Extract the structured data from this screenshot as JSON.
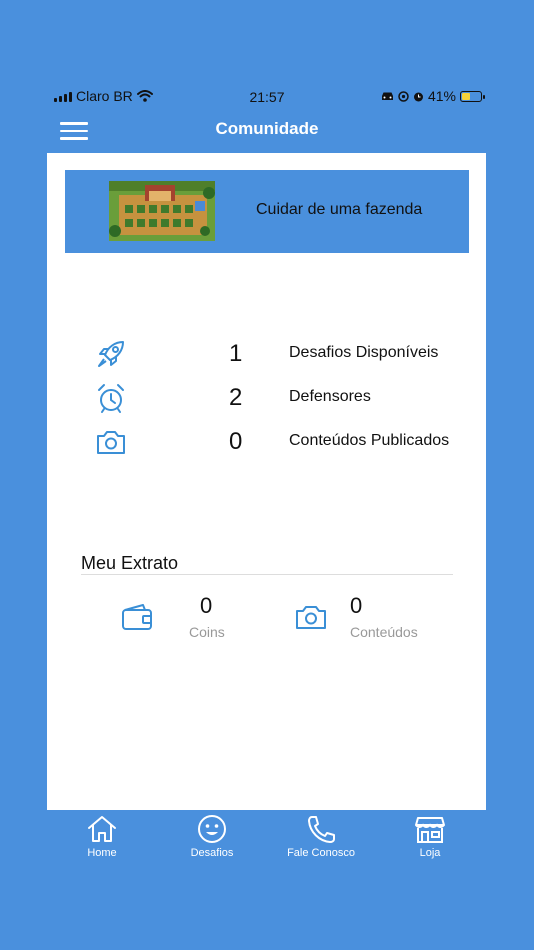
{
  "status_bar": {
    "carrier": "Claro BR",
    "time": "21:57",
    "battery": "41%"
  },
  "header": {
    "title": "Comunidade",
    "menu_icon": "menu-icon"
  },
  "banner": {
    "title": "Cuidar de uma fazenda",
    "image": "farm-game-thumbnail"
  },
  "stats": [
    {
      "icon": "rocket-icon",
      "value": "1",
      "label": "Desafios Disponíveis"
    },
    {
      "icon": "alarm-clock-icon",
      "value": "2",
      "label": "Defensores"
    },
    {
      "icon": "camera-icon",
      "value": "0",
      "label": "Conteúdos Publicados"
    }
  ],
  "extrato": {
    "title": "Meu Extrato",
    "items": [
      {
        "icon": "wallet-icon",
        "value": "0",
        "label": "Coins"
      },
      {
        "icon": "camera-icon",
        "value": "0",
        "label": "Conteúdos"
      }
    ]
  },
  "tabs": [
    {
      "icon": "home-icon",
      "label": "Home"
    },
    {
      "icon": "smiley-icon",
      "label": "Desafios"
    },
    {
      "icon": "phone-icon",
      "label": "Fale Conosco"
    },
    {
      "icon": "store-icon",
      "label": "Loja"
    }
  ],
  "colors": {
    "primary": "#4a90dd",
    "icon_blue": "#3a8fd6",
    "muted": "#999999"
  }
}
